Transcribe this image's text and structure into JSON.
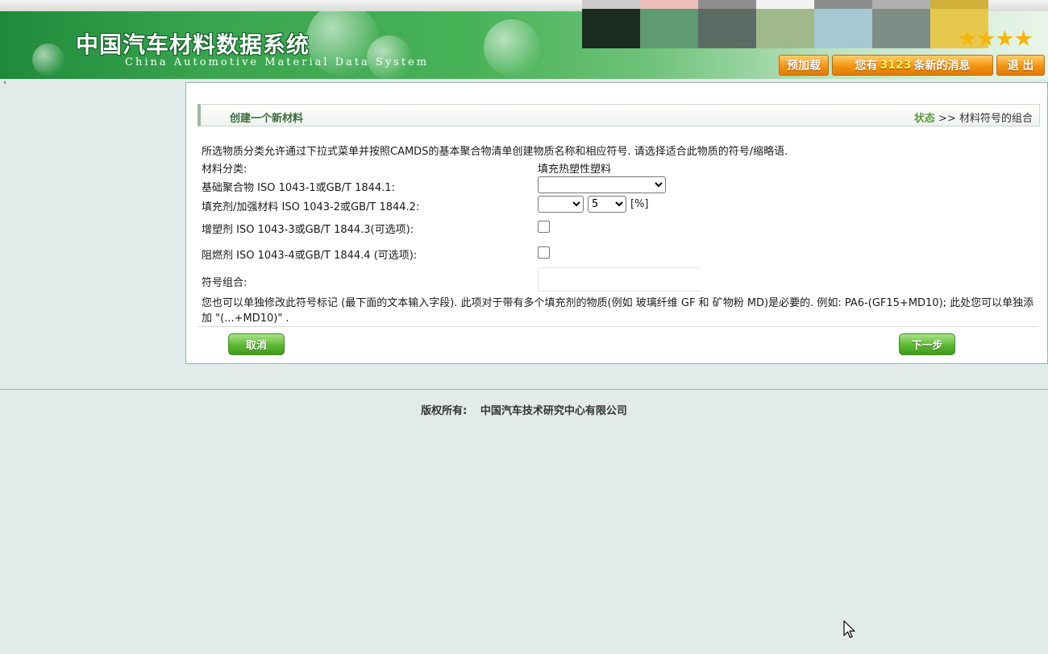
{
  "header": {
    "title_cn": "中国汽车材料数据系统",
    "title_en": "China Automotive  Material  Data  System",
    "stars": "★★★★",
    "preload_button": "预加载",
    "messages_prefix": "您有",
    "messages_count": "3123",
    "messages_suffix": "条新的消息",
    "logout_button": "退 出",
    "swatches": [
      {
        "top": "#cccccc",
        "bottom": "#1b2b22"
      },
      {
        "top": "#ecc0bc",
        "bottom": "#5f9a70"
      },
      {
        "top": "#8f8f8f",
        "bottom": "#5c6b64"
      },
      {
        "top": "#f2f2f2",
        "bottom": "#a0b98a"
      },
      {
        "top": "#8c8c8c",
        "bottom": "#a6c8d2"
      },
      {
        "top": "#b0b0b0",
        "bottom": "#7e8e86"
      },
      {
        "top": "#cfb13c",
        "bottom": "#e6c84e"
      }
    ]
  },
  "panel": {
    "title": "创建一个新材料",
    "status_label": "状态",
    "status_sep": ">>",
    "status_value": "材料符号的组合",
    "description": "所选物质分类允许通过下拉式菜单并按照CAMDS的基本聚合物清单创建物质名称和相应符号. 请选择适合此物质的符号/缩略语.",
    "material_class_label": "材料分类:",
    "material_class_value": "填充热塑性塑料",
    "base_polymer_label": "基础聚合物 ISO 1043-1或GB/T 1844.1:",
    "base_polymer_value": "",
    "filler_label": "填充剂/加强材料 ISO 1043-2或GB/T 1844.2:",
    "filler_value": "",
    "filler_percent_value": "5",
    "percent_unit": "[%]",
    "plasticizer_label": "增塑剂 ISO 1043-3或GB/T 1844.3(可选项):",
    "flame_retardant_label": "阻燃剂 ISO 1043-4或GB/T 1844.4 (可选项):",
    "symbol_label": "符号组合:",
    "symbol_value": "",
    "note": "您也可以单独修改此符号标记 (最下面的文本输入字段). 此项对于带有多个填充剂的物质(例如 玻璃纤维 GF 和 矿物粉 MD)是必要的. 例如: PA6-(GF15+MD10); 此处您可以单独添加 \"(...+MD10)\" .",
    "cancel_button": "取消",
    "next_button": "下一步"
  },
  "footer": {
    "label": "版权所有:",
    "company": "中国汽车技术研究中心有限公司"
  }
}
